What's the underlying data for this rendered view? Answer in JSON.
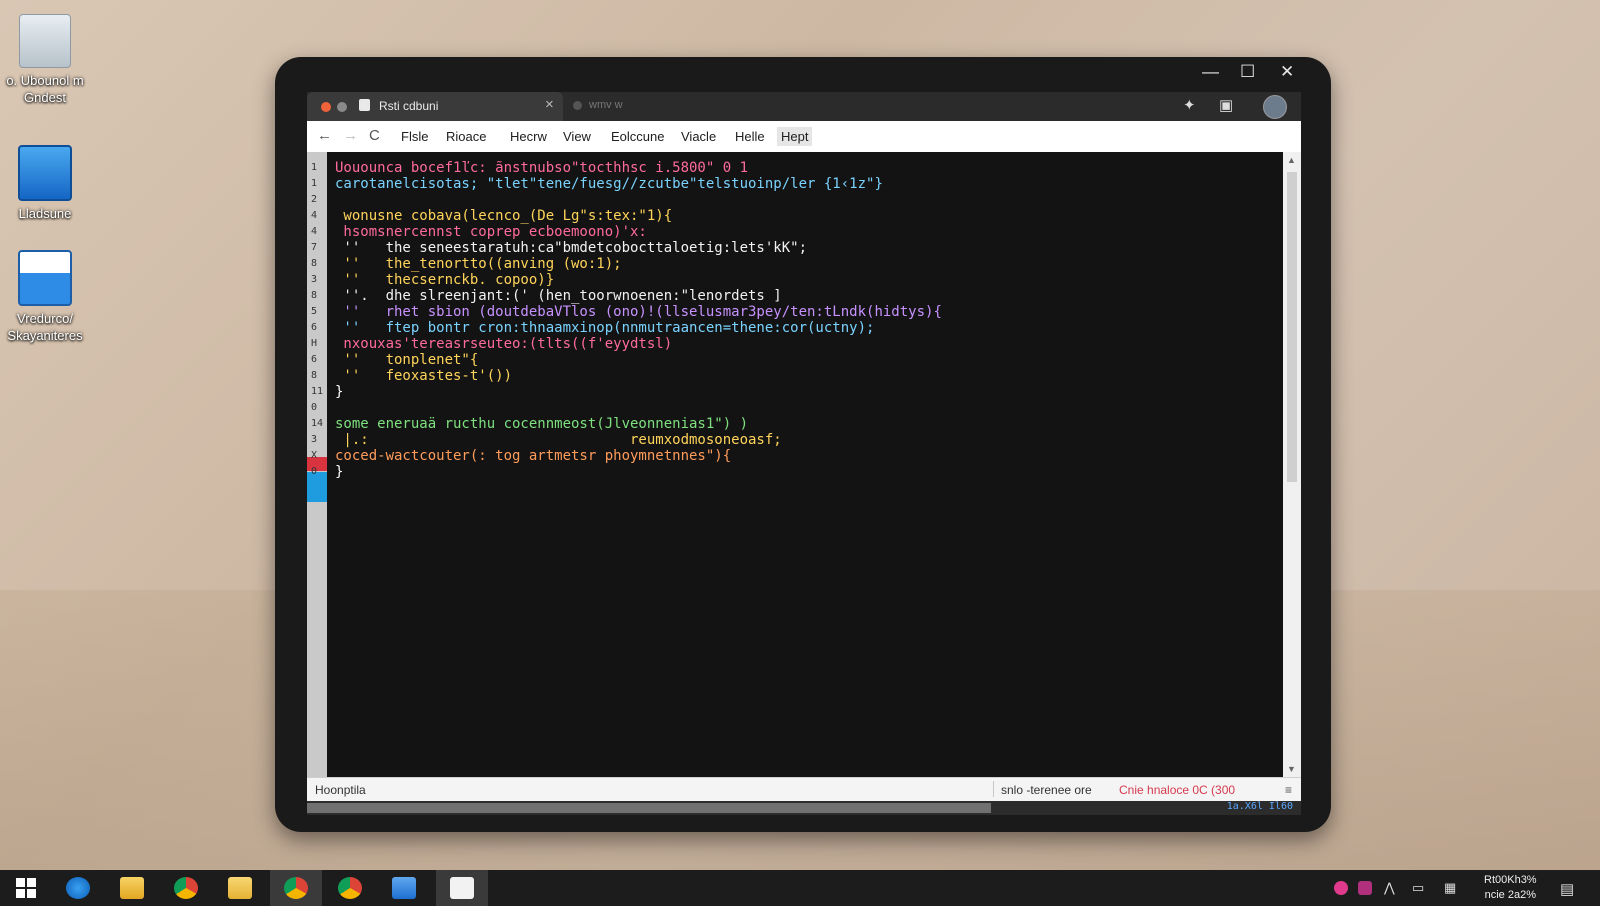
{
  "desktop": {
    "icons": [
      {
        "label": "o. Ubounol m\nGndest",
        "icon": "recycle-bin-icon"
      },
      {
        "label": "Lladsune",
        "icon": "computer-icon"
      },
      {
        "label": "Vredurco/\nSkayaniteres",
        "icon": "window-app-icon"
      }
    ]
  },
  "window": {
    "controls": {
      "minimize": "—",
      "maximize": "☐",
      "close": "✕"
    },
    "tab_title": "Rsti cdbuni",
    "tab_close": "×",
    "tab2_title": "wmv w",
    "menu": [
      "Flsle",
      "Rioace",
      "Hecrw",
      "View",
      "Eolccune",
      "Viacle",
      "Helle",
      "Hept"
    ],
    "nav": {
      "back": "←",
      "forward": "→",
      "reload": "C"
    }
  },
  "editor": {
    "gutter_numbers": [
      "1",
      "1",
      "2",
      "4",
      "4",
      "7",
      "8",
      "3",
      "8",
      "5",
      "6",
      "H",
      "6",
      "8",
      "11",
      "0",
      "14",
      "3",
      "X",
      "0"
    ],
    "lines": [
      {
        "text": "Uouounca bocef1ľc: ãnstnubso\"tocthhsc i.5800\" 0 1",
        "color": "#ff6b9a"
      },
      {
        "text": "carotanelcisotas; \"tlet\"tene/fuesg//zcutbe\"telstuoinp/ler {1‹1z\"}",
        "color": "#7ad3ff"
      },
      {
        "text": "",
        "color": "#ffffff"
      },
      {
        "text": " wonusne cobava(lecnco_(De Lg\"s:tex:\"1){",
        "color": "#ffd45a"
      },
      {
        "text": " hsomsnercennst coprep ecboemoono)'x:",
        "color": "#ff6b9a"
      },
      {
        "text": " ''   the seneestaratuh:ca\"bmdetcobocttaloetig:lets'kK\";",
        "color": "#f2f2f2"
      },
      {
        "text": " ''   the_tenortto((anving (wo:1);",
        "color": "#ffd45a"
      },
      {
        "text": " ''   thecsernckb. copoo)}",
        "color": "#ffd45a"
      },
      {
        "text": " ''.  dhe slreenjant:(' (hen_toorwnoenen:\"lenordets ]",
        "color": "#f2f2f2"
      },
      {
        "text": " ''   rhet sbion (doutdebaVTlos (ono)!(llselusmar3pey/ten:tLndk(hidtys){",
        "color": "#c792ff"
      },
      {
        "text": " ''   ftep bontr cron:thnaamxinop(nnmutraancen=thene:cor(uctny);",
        "color": "#7ad3ff"
      },
      {
        "text": " nxouxas'tereasrseuteo:(tlts((f'eyydtsl)",
        "color": "#ff6b9a"
      },
      {
        "text": " ''   tonplenet\"{",
        "color": "#ffd45a"
      },
      {
        "text": " ''   feoxastes-t'())",
        "color": "#ffd45a"
      },
      {
        "text": "}",
        "color": "#ffffff"
      },
      {
        "text": "",
        "color": "#ffffff"
      },
      {
        "text": "some eneruaä ructhu cocennmeost(Jlveonnenias1\") )",
        "color": "#7ee07e"
      },
      {
        "text": " |.:                               reumxodmosoneoasf;",
        "color": "#ffd45a"
      },
      {
        "text": "coced-wactcouter(: tog artmetsr phoymnetnnes\"){",
        "color": "#ff9c5a"
      },
      {
        "text": "}",
        "color": "#ffffff"
      }
    ]
  },
  "statusbar": {
    "left": "Hoonptila",
    "middle": "snlo -terenee ore",
    "right": "Cnie hnaloce  0C (300",
    "scroll_info": "1a.X6l Il60"
  },
  "taskbar": {
    "apps": [
      "start-icon",
      "edge-icon",
      "file-explorer-icon",
      "chrome-icon",
      "folder-icon",
      "chrome-icon",
      "chrome-icon",
      "store-icon",
      "notepad-icon"
    ],
    "clock_time": "Rt00Kh3%",
    "clock_date": "ncie 2a2%"
  },
  "colors": {
    "editor_bg": "#131313",
    "accent_orange": "#e0a33a",
    "gutter_marker": "#d7343f",
    "gutter_blue": "#1f9be0"
  }
}
